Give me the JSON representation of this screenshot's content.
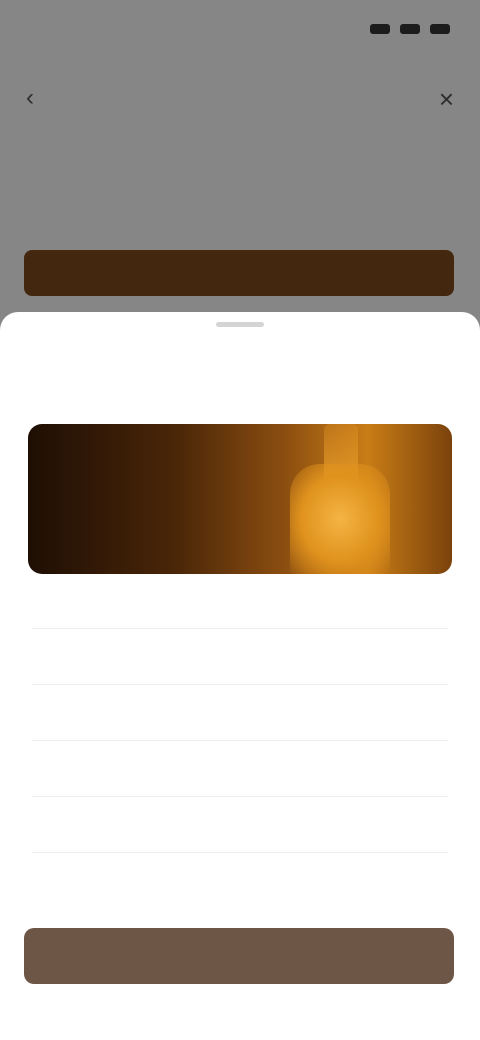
{
  "status_bar": {
    "time": ""
  },
  "background_page": {
    "title": "",
    "button_label": "",
    "colors": {
      "accent": "#7a4a1c",
      "overlay": "rgba(0,0,0,0.45)"
    }
  },
  "sheet": {
    "title": "",
    "hero_image_icon": "bottle-image",
    "product_name": "",
    "product_subtitle": "",
    "options": [
      "",
      "",
      ""
    ],
    "primary_button_label": "",
    "colors": {
      "primary_button": "#6e5646",
      "hero_glow": "#e0921d"
    }
  }
}
